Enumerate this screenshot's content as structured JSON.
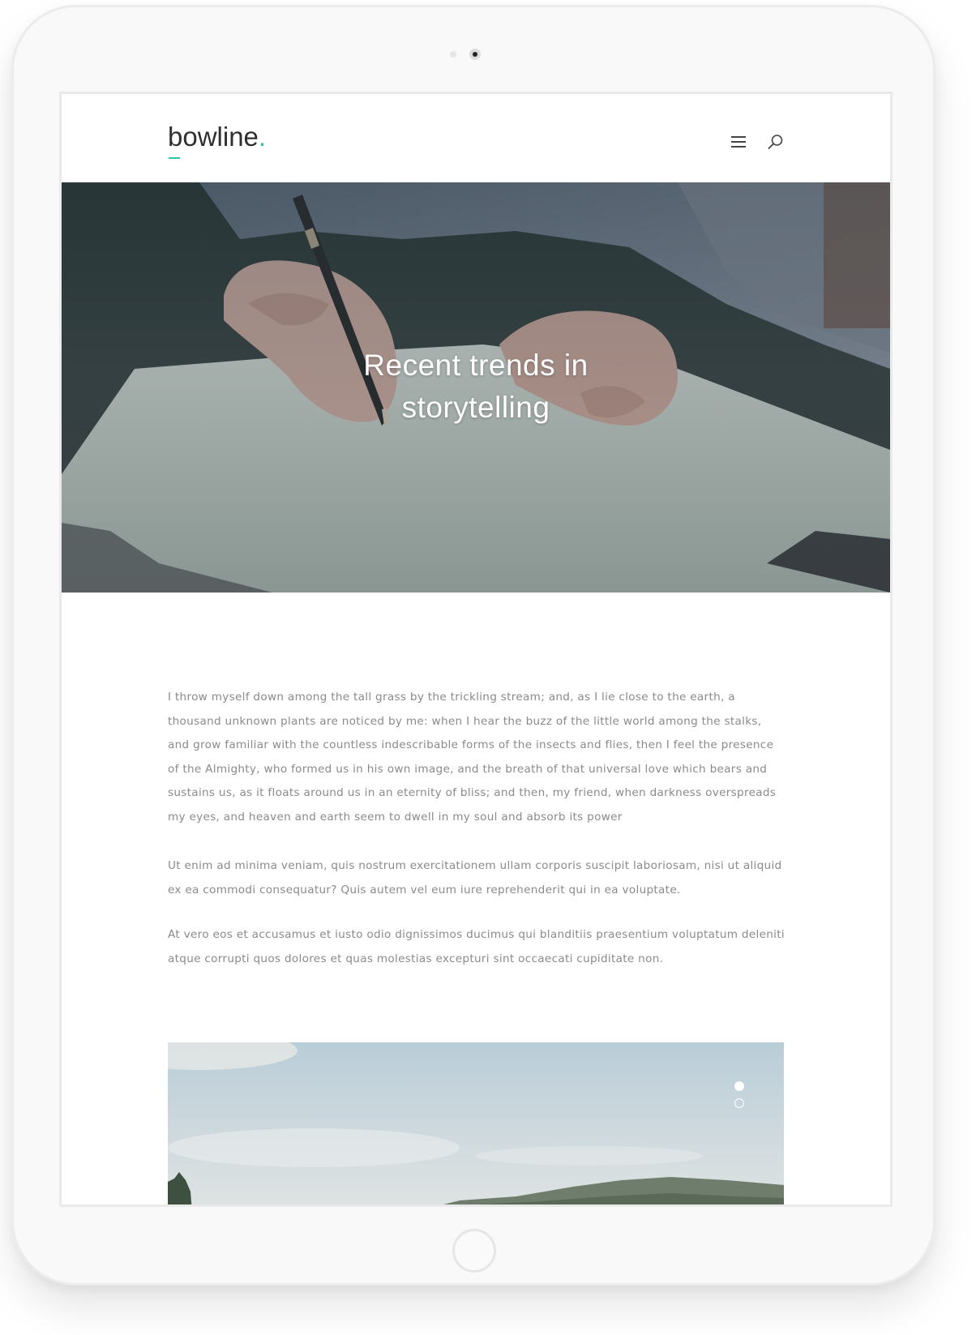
{
  "site": {
    "logo_text": "bowline",
    "logo_dot": ".",
    "accent_color": "#2ec4b6"
  },
  "header": {
    "icons": [
      "menu-icon",
      "search-icon"
    ]
  },
  "hero": {
    "title_line1": "Recent trends in",
    "title_line2": "storytelling"
  },
  "article": {
    "paragraphs": [
      "I throw myself down among the tall grass by the trickling stream; and, as I lie close to the earth, a thousand unknown plants are noticed by me: when I hear the buzz of the little world among the stalks, and grow familiar with the countless indescribable forms of the insects and flies, then I feel the presence of the Almighty, who formed us in his own image, and the breath of that universal love which bears and sustains us, as it floats around us in an eternity of bliss; and then, my friend, when darkness overspreads my eyes, and heaven and earth seem to dwell in my soul and absorb its power",
      "Ut enim ad minima veniam, quis nostrum exercitationem ullam corporis suscipit laboriosam, nisi ut aliquid ex ea commodi consequatur? Quis autem vel eum iure reprehenderit qui in ea voluptate.",
      "At vero eos et accusamus et iusto odio dignissimos ducimus qui blanditiis praesentium voluptatum deleniti atque corrupti quos dolores et quas molestias excepturi sint occaecati cupiditate non."
    ]
  },
  "gallery": {
    "slide_count": 2,
    "active_slide": 1
  }
}
